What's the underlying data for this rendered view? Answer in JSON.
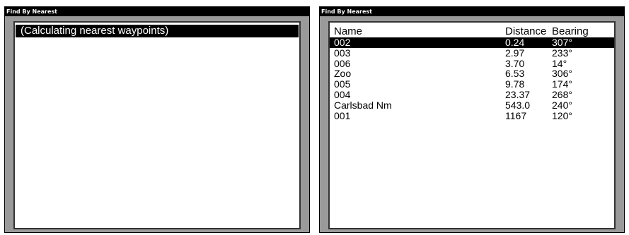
{
  "left_screen": {
    "title": "Find By Nearest",
    "status_text": "(Calculating nearest waypoints)"
  },
  "right_screen": {
    "title": "Find By Nearest",
    "columns": {
      "name": "Name",
      "distance": "Distance",
      "bearing": "Bearing"
    },
    "rows": [
      {
        "name": "002",
        "distance": "0.24",
        "bearing": "307°",
        "selected": true
      },
      {
        "name": "003",
        "distance": "2.97",
        "bearing": "233°"
      },
      {
        "name": "006",
        "distance": "3.70",
        "bearing": "14°"
      },
      {
        "name": "Zoo",
        "distance": "6.53",
        "bearing": "306°"
      },
      {
        "name": "005",
        "distance": "9.78",
        "bearing": "174°"
      },
      {
        "name": "004",
        "distance": "23.37",
        "bearing": "268°"
      },
      {
        "name": "Carlsbad Nm",
        "distance": "543.0",
        "bearing": "240°"
      },
      {
        "name": "001",
        "distance": "1167",
        "bearing": "120°"
      }
    ]
  }
}
